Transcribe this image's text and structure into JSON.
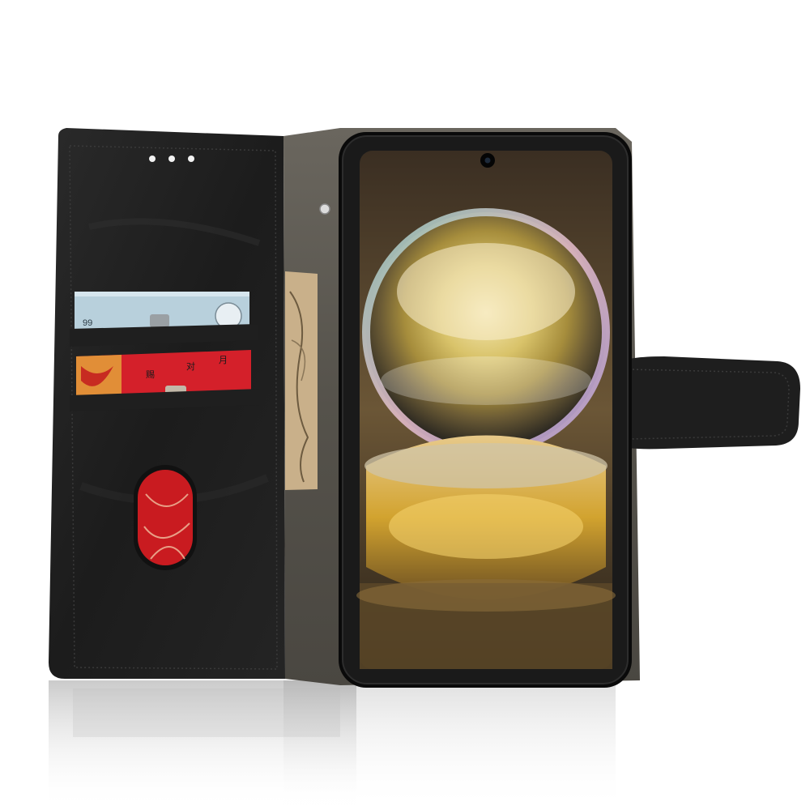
{
  "scene": {
    "product": "phone-wallet-case",
    "case_color": "#1c1c1c",
    "lining_color": "#5d5a54",
    "background_color": "#ffffff",
    "card_blue_text": "99",
    "card_red_glyphs": [
      "赐",
      "对",
      "月"
    ]
  },
  "colors": {
    "leather_dark": "#1b1b1b",
    "leather_mid": "#2a2a2a",
    "lining": "#5a5750",
    "card_blue": "#b8d0dc",
    "card_red": "#d4202a",
    "money": "#c9b08a",
    "screen_bezel": "#0a0a0a",
    "wallpaper_gold": "#d8b64a"
  }
}
